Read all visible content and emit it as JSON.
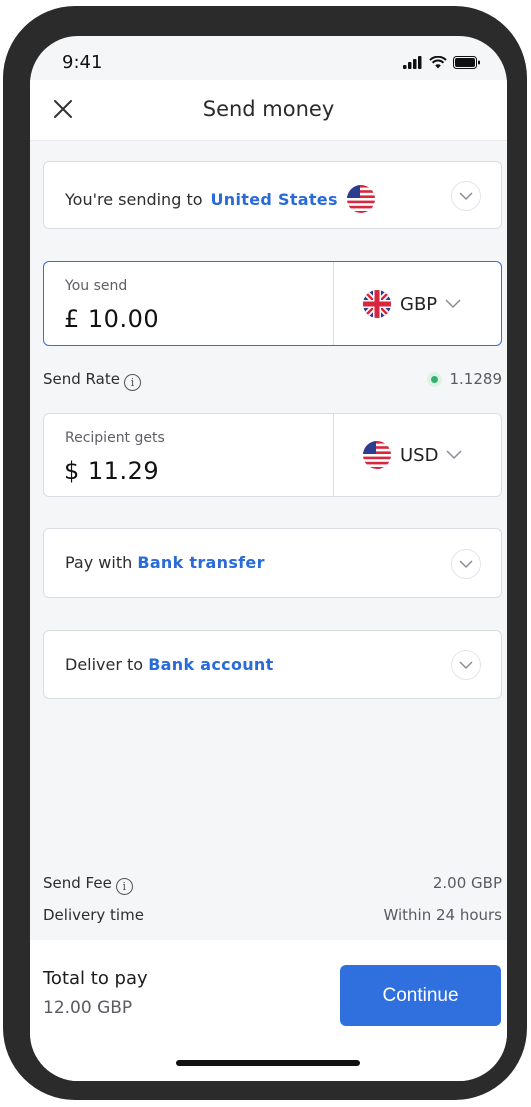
{
  "status_bar": {
    "time": "9:41"
  },
  "header": {
    "title": "Send money",
    "close_icon": "close-icon"
  },
  "destination": {
    "prefix": "You're sending to",
    "country": "United States",
    "flag_icon": "us-flag-icon"
  },
  "send": {
    "label": "You send",
    "amount": "£ 10.00",
    "currency": "GBP",
    "flag_icon": "uk-flag-icon"
  },
  "rate": {
    "label": "Send Rate",
    "value": "1.1289",
    "indicator_color": "#2fb36d"
  },
  "receive": {
    "label": "Recipient gets",
    "amount": "$ 11.29",
    "currency": "USD",
    "flag_icon": "us-flag-icon"
  },
  "pay_with": {
    "prefix": "Pay with",
    "method": "Bank transfer"
  },
  "deliver_to": {
    "prefix": "Deliver to",
    "method": "Bank account"
  },
  "fees": {
    "fee_label": "Send Fee",
    "fee_value": "2.00 GBP",
    "delivery_label": "Delivery time",
    "delivery_value": "Within 24 hours"
  },
  "total": {
    "label": "Total to pay",
    "value": "12.00 GBP"
  },
  "continue_label": "Continue",
  "colors": {
    "accent": "#2f6fde",
    "link": "#2a6bd8",
    "rate_dot": "#2fb36d"
  }
}
